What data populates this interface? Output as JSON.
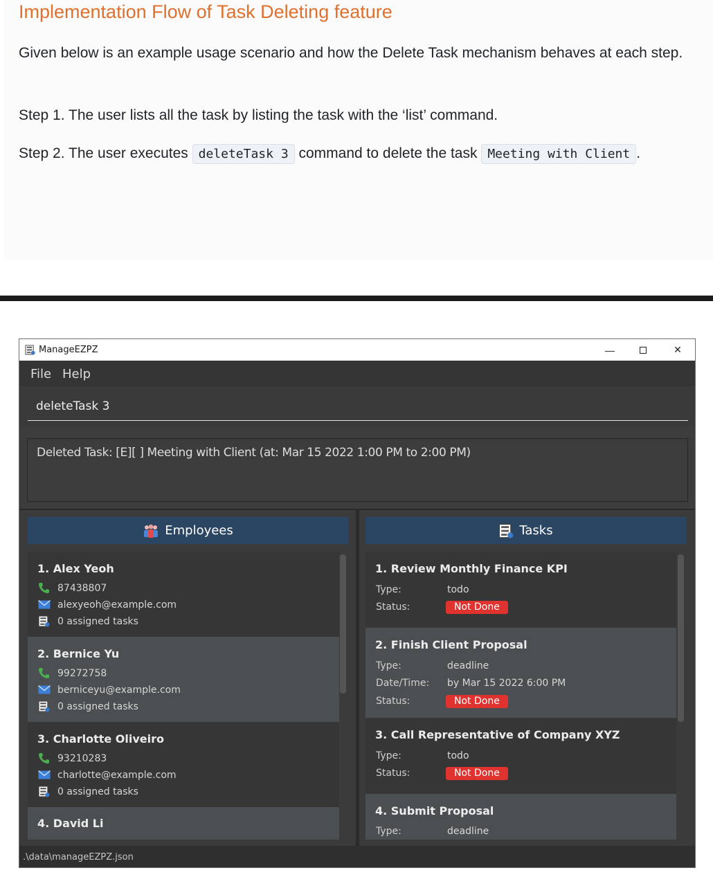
{
  "doc": {
    "title": "Implementation Flow of Task Deleting feature",
    "intro": "Given below is an example usage scenario and how the Delete Task mechanism behaves at each step.",
    "step1": "Step 1. The user lists all the task by listing the task with the ‘list’ command.",
    "step2_prefix": "Step 2. The user executes",
    "step2_code": "deleteTask 3",
    "step2_middle": "command to delete the task",
    "step2_code2": "Meeting with Client",
    "step2_suffix": "."
  },
  "app": {
    "title": "ManageEZPZ",
    "controls": {
      "minimize": "—",
      "close": "✕"
    },
    "menu": {
      "file": "File",
      "help": "Help"
    },
    "command_value": "deleteTask 3",
    "result": "Deleted Task: [E][ ] Meeting with Client (at: Mar 15 2022 1:00 PM to 2:00 PM)",
    "status_path": ".\\data\\manageEZPZ.json",
    "accent_header": "#2b4663",
    "badge_color": "#e0332f"
  },
  "employees": {
    "header": "Employees",
    "items": [
      {
        "name": "1.  Alex Yeoh",
        "phone": "87438807",
        "email": "alexyeoh@example.com",
        "tasks": "0 assigned tasks"
      },
      {
        "name": "2.  Bernice Yu",
        "phone": "99272758",
        "email": "berniceyu@example.com",
        "tasks": "0 assigned tasks"
      },
      {
        "name": "3.  Charlotte Oliveiro",
        "phone": "93210283",
        "email": "charlotte@example.com",
        "tasks": "0 assigned tasks"
      },
      {
        "name": "4.  David Li"
      }
    ]
  },
  "tasks": {
    "header": "Tasks",
    "labels": {
      "type": "Type:",
      "status": "Status:",
      "datetime": "Date/Time:"
    },
    "items": [
      {
        "name": "1.  Review Monthly Finance KPI",
        "type": "todo",
        "status": "Not Done"
      },
      {
        "name": "2.  Finish Client Proposal",
        "type": "deadline",
        "datetime": "by Mar 15 2022 6:00 PM",
        "status": "Not Done"
      },
      {
        "name": "3.  Call Representative of Company XYZ",
        "type": "todo",
        "status": "Not Done"
      },
      {
        "name": "4.  Submit Proposal",
        "type": "deadline"
      }
    ]
  }
}
